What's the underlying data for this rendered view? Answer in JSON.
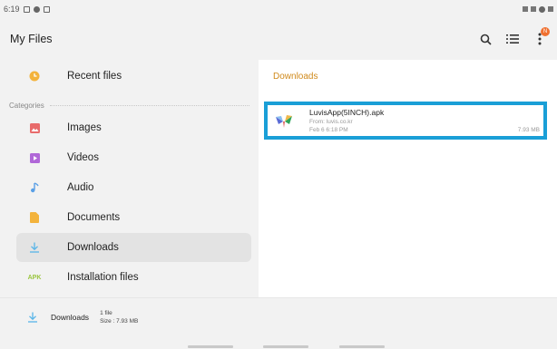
{
  "status_bar": {
    "time": "6:19"
  },
  "header": {
    "title": "My Files",
    "badge": "N",
    "icons": [
      "search-icon",
      "list-view-icon",
      "more-options-icon"
    ]
  },
  "sidebar": {
    "recent": {
      "label": "Recent files",
      "icon": "clock-icon"
    },
    "categories_label": "Categories",
    "items": [
      {
        "label": "Images",
        "icon": "image-icon",
        "color": "#e86b6b"
      },
      {
        "label": "Videos",
        "icon": "video-icon",
        "color": "#b067d8"
      },
      {
        "label": "Audio",
        "icon": "music-note-icon",
        "color": "#5aa0e6"
      },
      {
        "label": "Documents",
        "icon": "document-icon",
        "color": "#f3b33c"
      },
      {
        "label": "Downloads",
        "icon": "download-icon",
        "color": "#58b5e8",
        "selected": true
      },
      {
        "label": "Installation files",
        "icon": "apk-icon",
        "icon_text": "APK",
        "color": "#9ac53e"
      }
    ]
  },
  "content": {
    "title": "Downloads",
    "file": {
      "name": "LuvisApp(5INCH).apk",
      "from": "From: luvis.co.kr",
      "date": "Feb 6 6:18 PM",
      "size": "7.93 MB"
    }
  },
  "footer": {
    "folder": "Downloads",
    "count": "1 file",
    "size": "Size : 7.93 MB"
  },
  "colors": {
    "accent_orange": "#d08a1c",
    "selection_border": "#1a9fd7",
    "badge": "#f07030"
  }
}
